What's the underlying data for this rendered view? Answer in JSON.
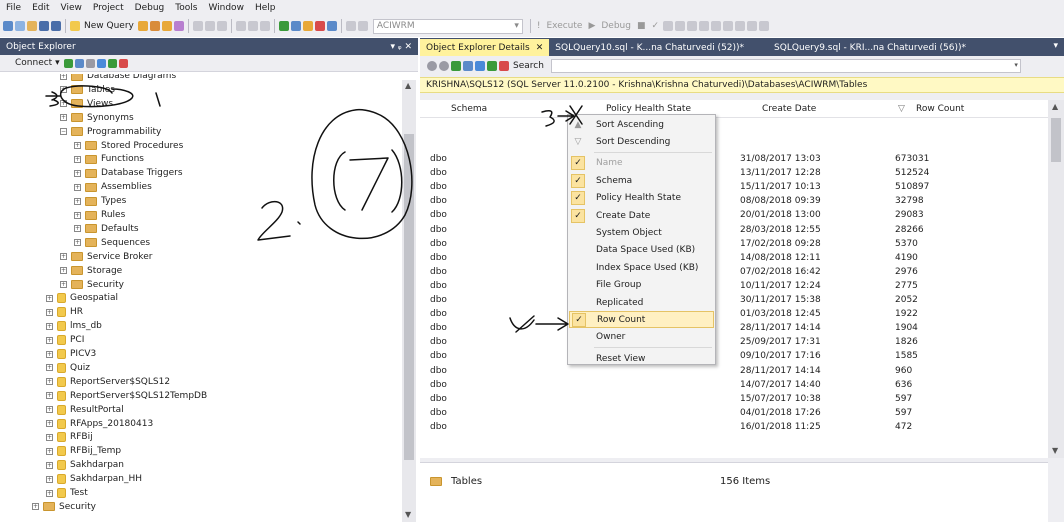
{
  "menu": [
    "File",
    "Edit",
    "View",
    "Project",
    "Debug",
    "Tools",
    "Window",
    "Help"
  ],
  "toolbar": {
    "new_query": "New Query",
    "database": "ACIWRM",
    "execute": "Execute",
    "debug": "Debug"
  },
  "object_explorer": {
    "title": "Object Explorer",
    "pin": "▾ ᵩ ✕",
    "connect": "Connect ▾",
    "tree": [
      {
        "label": "Database Diagrams",
        "indent": 60,
        "icon": "folder",
        "exp": "+"
      },
      {
        "label": "Tables",
        "indent": 60,
        "icon": "folder",
        "exp": "+"
      },
      {
        "label": "Views",
        "indent": 60,
        "icon": "folder",
        "exp": "+"
      },
      {
        "label": "Synonyms",
        "indent": 60,
        "icon": "folder",
        "exp": "+"
      },
      {
        "label": "Programmability",
        "indent": 60,
        "icon": "folder",
        "exp": "−"
      },
      {
        "label": "Stored Procedures",
        "indent": 74,
        "icon": "folder",
        "exp": "+"
      },
      {
        "label": "Functions",
        "indent": 74,
        "icon": "folder",
        "exp": "+"
      },
      {
        "label": "Database Triggers",
        "indent": 74,
        "icon": "folder",
        "exp": "+"
      },
      {
        "label": "Assemblies",
        "indent": 74,
        "icon": "folder",
        "exp": "+"
      },
      {
        "label": "Types",
        "indent": 74,
        "icon": "folder",
        "exp": "+"
      },
      {
        "label": "Rules",
        "indent": 74,
        "icon": "folder",
        "exp": "+"
      },
      {
        "label": "Defaults",
        "indent": 74,
        "icon": "folder",
        "exp": "+"
      },
      {
        "label": "Sequences",
        "indent": 74,
        "icon": "folder",
        "exp": "+"
      },
      {
        "label": "Service Broker",
        "indent": 60,
        "icon": "folder",
        "exp": "+"
      },
      {
        "label": "Storage",
        "indent": 60,
        "icon": "folder",
        "exp": "+"
      },
      {
        "label": "Security",
        "indent": 60,
        "icon": "folder",
        "exp": "+"
      },
      {
        "label": "Geospatial",
        "indent": 46,
        "icon": "db",
        "exp": "+"
      },
      {
        "label": "HR",
        "indent": 46,
        "icon": "db",
        "exp": "+"
      },
      {
        "label": "lms_db",
        "indent": 46,
        "icon": "db",
        "exp": "+"
      },
      {
        "label": "PCI",
        "indent": 46,
        "icon": "db",
        "exp": "+"
      },
      {
        "label": "PICV3",
        "indent": 46,
        "icon": "db",
        "exp": "+"
      },
      {
        "label": "Quiz",
        "indent": 46,
        "icon": "db",
        "exp": "+"
      },
      {
        "label": "ReportServer$SQLS12",
        "indent": 46,
        "icon": "db",
        "exp": "+"
      },
      {
        "label": "ReportServer$SQLS12TempDB",
        "indent": 46,
        "icon": "db",
        "exp": "+"
      },
      {
        "label": "ResultPortal",
        "indent": 46,
        "icon": "db",
        "exp": "+"
      },
      {
        "label": "RFApps_20180413",
        "indent": 46,
        "icon": "db",
        "exp": "+"
      },
      {
        "label": "RFBij",
        "indent": 46,
        "icon": "db",
        "exp": "+"
      },
      {
        "label": "RFBij_Temp",
        "indent": 46,
        "icon": "db",
        "exp": "+"
      },
      {
        "label": "Sakhdarpan",
        "indent": 46,
        "icon": "db",
        "exp": "+"
      },
      {
        "label": "Sakhdarpan_HH",
        "indent": 46,
        "icon": "db",
        "exp": "+"
      },
      {
        "label": "Test",
        "indent": 46,
        "icon": "db",
        "exp": "+"
      },
      {
        "label": "Security",
        "indent": 32,
        "icon": "folder",
        "exp": "+"
      }
    ]
  },
  "tabs": [
    {
      "label": "Object Explorer Details",
      "close": "✕",
      "active": true
    },
    {
      "label": "SQLQuery10.sql - K...na Chaturvedi (52))*",
      "close": "",
      "active": false
    },
    {
      "label": "SQLQuery9.sql - KRI...na Chaturvedi (56))*",
      "close": "",
      "active": false
    }
  ],
  "details": {
    "search_label": "Search",
    "path": "KRISHNA\\SQLS12 (SQL Server 11.0.2100 - Krishna\\Krishna Chaturvedi)\\Databases\\ACIWRM\\Tables",
    "columns": {
      "schema": "Schema",
      "policy": "Policy Health State",
      "created": "Create Date",
      "rowcount": "Row Count",
      "sort_glyph": "▽"
    },
    "rows": [
      {
        "schema": "dbo",
        "date": "31/08/2017 13:03",
        "count": "673031"
      },
      {
        "schema": "dbo",
        "date": "13/11/2017 12:28",
        "count": "512524"
      },
      {
        "schema": "dbo",
        "date": "15/11/2017 10:13",
        "count": "510897"
      },
      {
        "schema": "dbo",
        "date": "08/08/2018 09:39",
        "count": "32798"
      },
      {
        "schema": "dbo",
        "date": "20/01/2018 13:00",
        "count": "29083"
      },
      {
        "schema": "dbo",
        "date": "28/03/2018 12:55",
        "count": "28266"
      },
      {
        "schema": "dbo",
        "date": "17/02/2018 09:28",
        "count": "5370"
      },
      {
        "schema": "dbo",
        "date": "14/08/2018 12:11",
        "count": "4190"
      },
      {
        "schema": "dbo",
        "date": "07/02/2018 16:42",
        "count": "2976"
      },
      {
        "schema": "dbo",
        "date": "10/11/2017 12:24",
        "count": "2775"
      },
      {
        "schema": "dbo",
        "date": "30/11/2017 15:38",
        "count": "2052"
      },
      {
        "schema": "dbo",
        "date": "01/03/2018 12:45",
        "count": "1922"
      },
      {
        "schema": "dbo",
        "date": "28/11/2017 14:14",
        "count": "1904"
      },
      {
        "schema": "dbo",
        "date": "25/09/2017 17:31",
        "count": "1826"
      },
      {
        "schema": "dbo",
        "date": "09/10/2017 17:16",
        "count": "1585"
      },
      {
        "schema": "dbo",
        "date": "28/11/2017 14:14",
        "count": "960"
      },
      {
        "schema": "dbo",
        "date": "14/07/2017 14:40",
        "count": "636"
      },
      {
        "schema": "dbo",
        "date": "15/07/2017 10:38",
        "count": "597"
      },
      {
        "schema": "dbo",
        "date": "04/01/2018 17:26",
        "count": "597"
      },
      {
        "schema": "dbo",
        "date": "16/01/2018 11:25",
        "count": "472"
      }
    ],
    "status": {
      "folder": "Tables",
      "items": "156 Items"
    }
  },
  "context_menu": [
    {
      "label": "Sort Ascending",
      "check": "sort",
      "state": "sort"
    },
    {
      "label": "Sort Descending",
      "check": "sort",
      "state": "sort"
    },
    {
      "sep": true
    },
    {
      "label": "Name",
      "check": true,
      "state": "disabled"
    },
    {
      "label": "Schema",
      "check": true,
      "state": "normal"
    },
    {
      "label": "Policy Health State",
      "check": true,
      "state": "normal"
    },
    {
      "label": "Create Date",
      "check": true,
      "state": "normal"
    },
    {
      "label": "System Object",
      "check": false,
      "state": "normal"
    },
    {
      "label": "Data Space Used (KB)",
      "check": false,
      "state": "normal"
    },
    {
      "label": "Index Space Used (KB)",
      "check": false,
      "state": "normal"
    },
    {
      "label": "File Group",
      "check": false,
      "state": "normal"
    },
    {
      "label": "Replicated",
      "check": false,
      "state": "normal"
    },
    {
      "label": "Row Count",
      "check": true,
      "state": "highlighted"
    },
    {
      "label": "Owner",
      "check": false,
      "state": "normal"
    },
    {
      "sep": true
    },
    {
      "label": "Reset View",
      "check": false,
      "state": "normal"
    }
  ],
  "colors": {
    "accent": "#42506C",
    "active_tab": "#FFF29D",
    "path_bar": "#FFF9C4",
    "check": "#FBE3A0"
  }
}
